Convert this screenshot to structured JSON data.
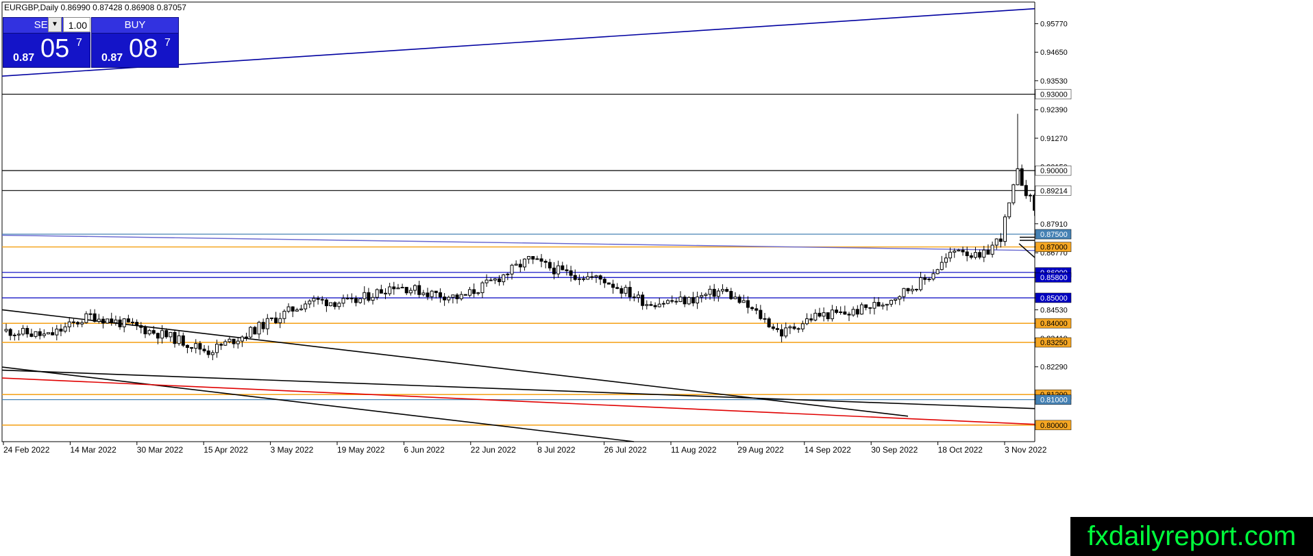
{
  "header": {
    "title": "EURGBP,Daily 0.86990 0.87428 0.86908 0.87057"
  },
  "trade_panel": {
    "sell_label": "SELL",
    "buy_label": "BUY",
    "lots": "1.00",
    "sell_small": "0.87",
    "sell_big": "05",
    "sell_sup": "7",
    "buy_small": "0.87",
    "buy_big": "08",
    "buy_sup": "7"
  },
  "watermark": "fxdailyreport.com",
  "colors": {
    "orange": "#f5a623",
    "blue": "#0000c0",
    "red": "#e00000",
    "black": "#000000",
    "sellbuy": "#1414c8"
  },
  "chart_data": {
    "type": "candlestick",
    "symbol": "EURGBP",
    "timeframe": "Daily",
    "ylim": [
      0.7935,
      0.9662
    ],
    "y_ticks": [
      "0.95770",
      "0.94650",
      "0.93530",
      "0.92390",
      "0.91270",
      "0.90150",
      "0.87910",
      "0.86770",
      "0.84530",
      "0.83410",
      "0.82290"
    ],
    "x_labels": [
      "24 Feb 2022",
      "14 Mar 2022",
      "30 Mar 2022",
      "15 Apr 2022",
      "3 May 2022",
      "19 May 2022",
      "6 Jun 2022",
      "22 Jun 2022",
      "8 Jul 2022",
      "26 Jul 2022",
      "11 Aug 2022",
      "29 Aug 2022",
      "14 Sep 2022",
      "30 Sep 2022",
      "18 Oct 2022",
      "3 Nov 2022"
    ],
    "levels": [
      {
        "value": 0.93,
        "label": "0.93000",
        "color": "black"
      },
      {
        "value": 0.9,
        "label": "0.90000",
        "color": "black"
      },
      {
        "value": 0.89214,
        "label": "0.89214",
        "color": "black"
      },
      {
        "value": 0.875,
        "label": "0.87500",
        "color": "steelblue"
      },
      {
        "value": 0.87,
        "label": "0.87000",
        "color": "orange"
      },
      {
        "value": 0.86,
        "label": "0.86000",
        "color": "blue"
      },
      {
        "value": 0.858,
        "label": "0.85800",
        "color": "blue"
      },
      {
        "value": 0.85,
        "label": "0.85000",
        "color": "blue"
      },
      {
        "value": 0.84,
        "label": "0.84000",
        "color": "orange"
      },
      {
        "value": 0.8325,
        "label": "0.83250",
        "color": "orange"
      },
      {
        "value": 0.812,
        "label": "0.81200",
        "color": "orange"
      },
      {
        "value": 0.81,
        "label": "0.81000",
        "color": "steelblue"
      },
      {
        "value": 0.8,
        "label": "0.80000",
        "color": "orange"
      }
    ],
    "anchors": [
      [
        0,
        0.837
      ],
      [
        10,
        0.835
      ],
      [
        20,
        0.843
      ],
      [
        30,
        0.839
      ],
      [
        40,
        0.834
      ],
      [
        48,
        0.829
      ],
      [
        56,
        0.835
      ],
      [
        64,
        0.842
      ],
      [
        72,
        0.849
      ],
      [
        82,
        0.848
      ],
      [
        92,
        0.855
      ],
      [
        100,
        0.852
      ],
      [
        108,
        0.85
      ],
      [
        116,
        0.857
      ],
      [
        124,
        0.865
      ],
      [
        132,
        0.86
      ],
      [
        142,
        0.857
      ],
      [
        152,
        0.848
      ],
      [
        162,
        0.849
      ],
      [
        170,
        0.853
      ],
      [
        178,
        0.844
      ],
      [
        184,
        0.836
      ],
      [
        192,
        0.843
      ],
      [
        200,
        0.844
      ],
      [
        208,
        0.848
      ],
      [
        218,
        0.857
      ],
      [
        226,
        0.87
      ],
      [
        231,
        0.865
      ],
      [
        236,
        0.874
      ],
      [
        240,
        0.899
      ],
      [
        244,
        0.885
      ],
      [
        248,
        0.878
      ],
      [
        254,
        0.87
      ],
      [
        258,
        0.876
      ],
      [
        262,
        0.883
      ],
      [
        266,
        0.866
      ],
      [
        270,
        0.867
      ],
      [
        276,
        0.869
      ],
      [
        280,
        0.859
      ],
      [
        284,
        0.86
      ],
      [
        288,
        0.87
      ],
      [
        290,
        0.875
      ],
      [
        292,
        0.8706
      ]
    ]
  }
}
